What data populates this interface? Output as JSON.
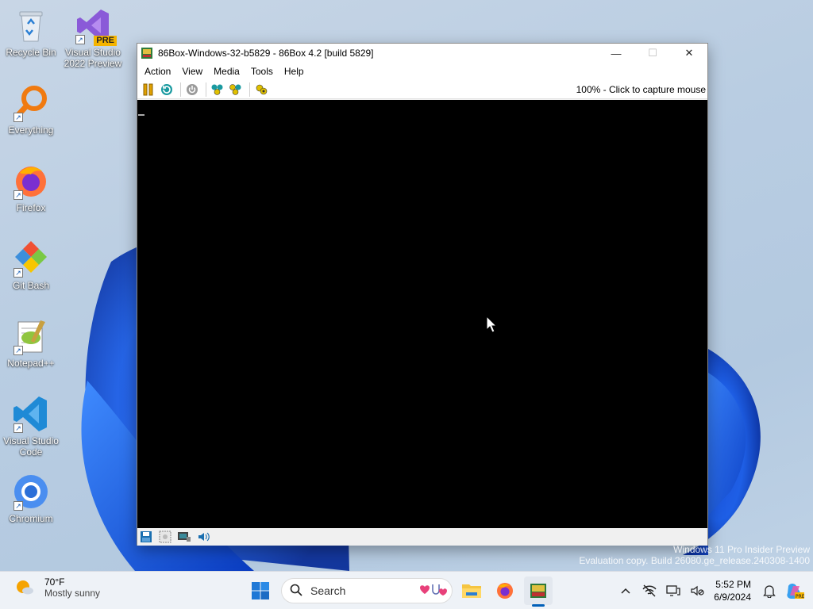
{
  "desktop": {
    "icons": [
      {
        "label": "Recycle Bin"
      },
      {
        "label": "Visual Studio 2022 Preview",
        "badge": "PRE"
      },
      {
        "label": "Everything"
      },
      {
        "label": "Firefox"
      },
      {
        "label": "Git Bash"
      },
      {
        "label": "Notepad++"
      },
      {
        "label": "Visual Studio Code"
      },
      {
        "label": "Chromium"
      }
    ],
    "watermark": {
      "line1": "Windows 11 Pro Insider Preview",
      "line2": "Evaluation copy. Build 26080.ge_release.240308-1400"
    }
  },
  "window": {
    "title": "86Box-Windows-32-b5829 - 86Box 4.2 [build 5829]",
    "controls": {
      "minimize": "—",
      "maximize": "☐",
      "close": "✕"
    },
    "menu": [
      "Action",
      "View",
      "Media",
      "Tools",
      "Help"
    ],
    "toolbar": {
      "icons": [
        "pause-icon",
        "reset-icon",
        "power-icon",
        "ctrl-alt-del-icon",
        "ctrl-alt-esc-icon",
        "settings-icon"
      ],
      "capture_text": "100% - Click to capture mouse"
    },
    "statusbar": {
      "icons": [
        "floppy-icon",
        "cdrom-icon",
        "network-icon",
        "sound-icon"
      ]
    }
  },
  "taskbar": {
    "weather": {
      "temp": "70°F",
      "condition": "Mostly sunny"
    },
    "search_placeholder": "Search",
    "apps": [
      "file-explorer-icon",
      "firefox-icon",
      "86box-icon"
    ],
    "clock": {
      "time": "5:52 PM",
      "date": "6/9/2024"
    }
  },
  "colors": {
    "accent": "#005fb8",
    "emulator_screen": "#000000",
    "window_bg": "#f0f0f0"
  }
}
